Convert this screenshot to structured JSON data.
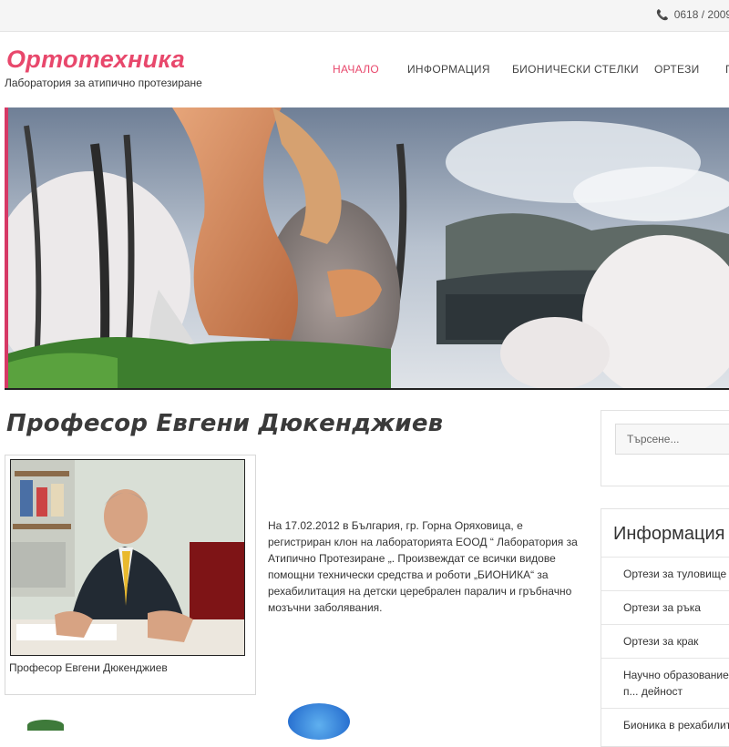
{
  "topbar": {
    "phone": "0618 / 2009",
    "phone_icon": "phone-icon"
  },
  "brand": {
    "logo": "Ортотехника",
    "tagline": "Лаборатория за атипично протезиране",
    "accent": "#e8486c"
  },
  "nav": {
    "items": [
      {
        "label": "Начало",
        "active": true
      },
      {
        "label": "Информация",
        "active": false
      },
      {
        "label": "Бионически стелки",
        "active": false
      },
      {
        "label": "Ортези",
        "active": false
      },
      {
        "label": "П",
        "active": false
      }
    ]
  },
  "article": {
    "title": "Професор Евгени Дюкенджиев",
    "photo_caption": "Професор Евгени Дюкенджиев",
    "body": "На 17.02.2012 в България, гр. Горна Оряховица, е регистриран клон на лабораторията ЕООД “ Лаборатория за Атипично Протезиране „. Произвеждат се всички видове помощни технически средства и роботи „БИОНИКА“ за рехабилитация на детски церебрален паралич и гръбначно мозъчни заболявания."
  },
  "sidebar": {
    "search_placeholder": "Търсене...",
    "info_title": "Информация",
    "items": [
      "Ортези за туловище",
      "Ортези за ръка",
      "Ортези за крак",
      "Научно образование, п... дейност",
      "Бионика в рехабилитация"
    ]
  }
}
